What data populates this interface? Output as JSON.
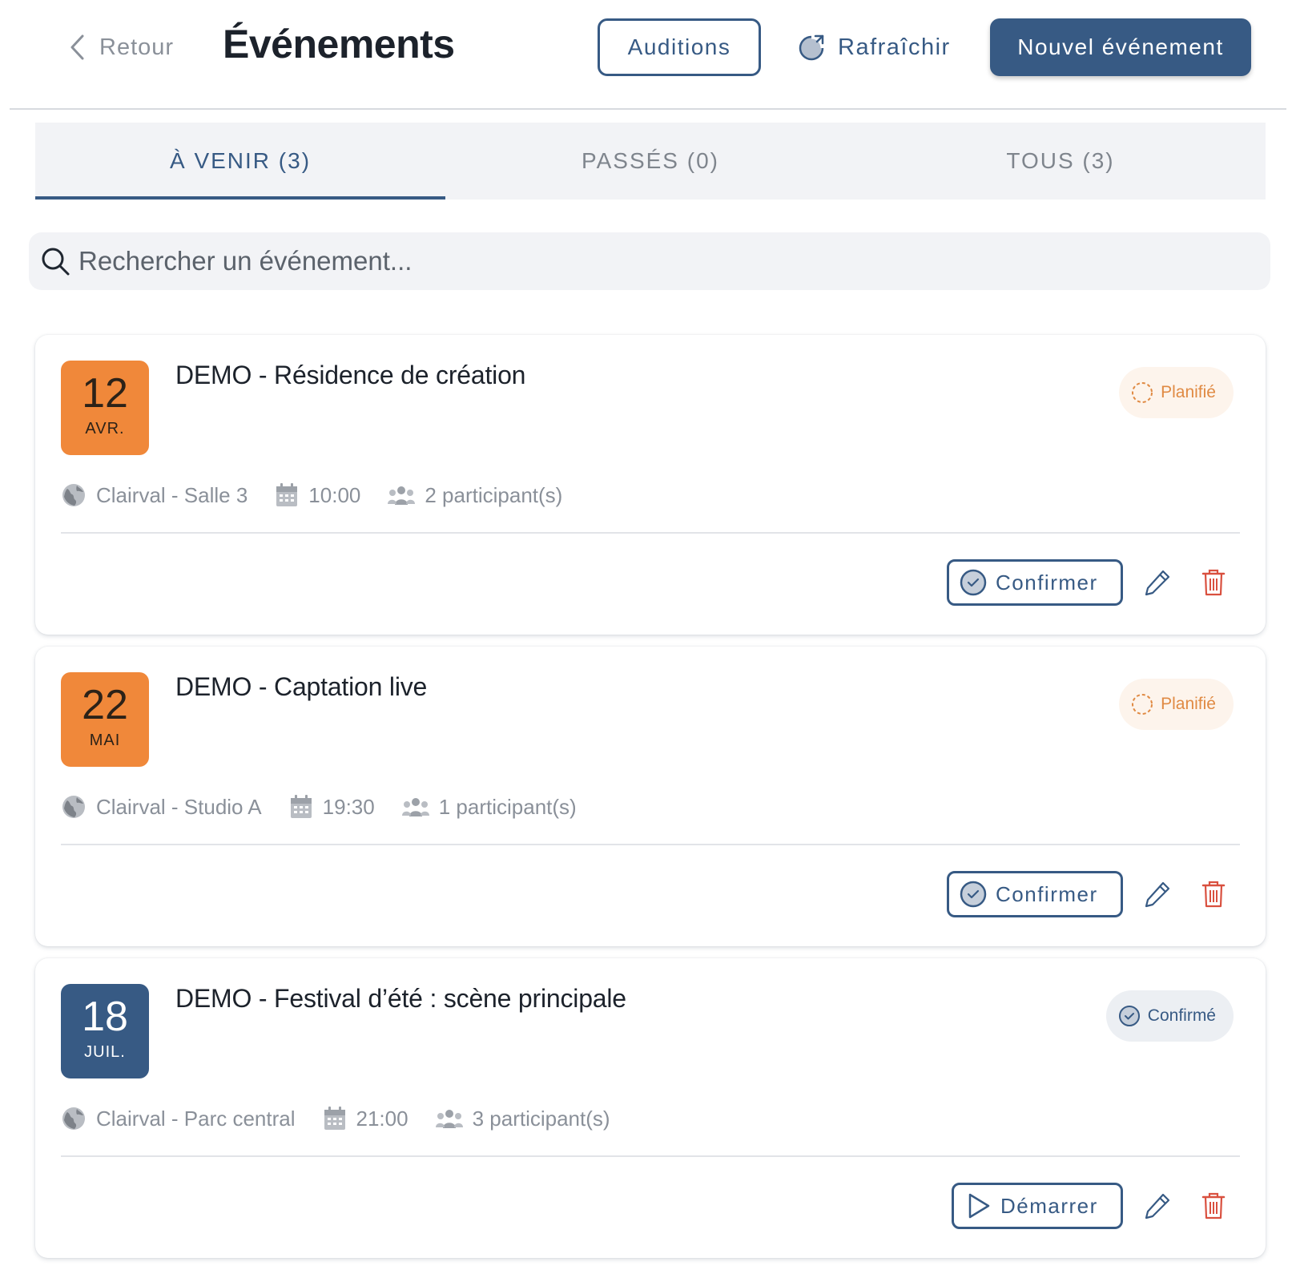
{
  "header": {
    "back_label": "Retour",
    "title": "Événements",
    "auditions_label": "Auditions",
    "refresh_label": "Rafraîchir",
    "new_event_label": "Nouvel événement"
  },
  "tabs": [
    {
      "label": "À VENIR (3)",
      "active": true
    },
    {
      "label": "PASSÉS (0)",
      "active": false
    },
    {
      "label": "TOUS (3)",
      "active": false
    }
  ],
  "search": {
    "placeholder": "Rechercher un événement...",
    "value": ""
  },
  "events": [
    {
      "day": "12",
      "month": "AVR.",
      "date_color": "orange",
      "title": "DEMO - Résidence de création",
      "status": "Planifié",
      "location": "Clairval - Salle 3",
      "time": "10:00",
      "participants": "2 participant(s)",
      "action_label": "Confirmer"
    },
    {
      "day": "22",
      "month": "MAI",
      "date_color": "orange",
      "title": "DEMO - Captation live",
      "status": "Planifié",
      "location": "Clairval - Studio A",
      "time": "19:30",
      "participants": "1 participant(s)",
      "action_label": "Confirmer"
    },
    {
      "day": "18",
      "month": "JUIL.",
      "date_color": "blue",
      "title": "DEMO - Festival d’été : scène principale",
      "status": "Confirmé",
      "location": "Clairval - Parc central",
      "time": "21:00",
      "participants": "3 participant(s)",
      "action_label": "Démarrer"
    }
  ],
  "colors": {
    "primary": "#375a84",
    "orange": "#f0883a",
    "danger": "#d9503f",
    "planned": "#e08a43"
  },
  "icons": {
    "back": "chevron-left-icon",
    "refresh": "refresh-icon",
    "search": "search-icon",
    "location": "globe-icon",
    "time": "calendar-icon",
    "participants": "people-icon",
    "confirm": "check-circle-icon",
    "start": "play-icon",
    "edit": "pencil-icon",
    "delete": "trash-icon"
  }
}
